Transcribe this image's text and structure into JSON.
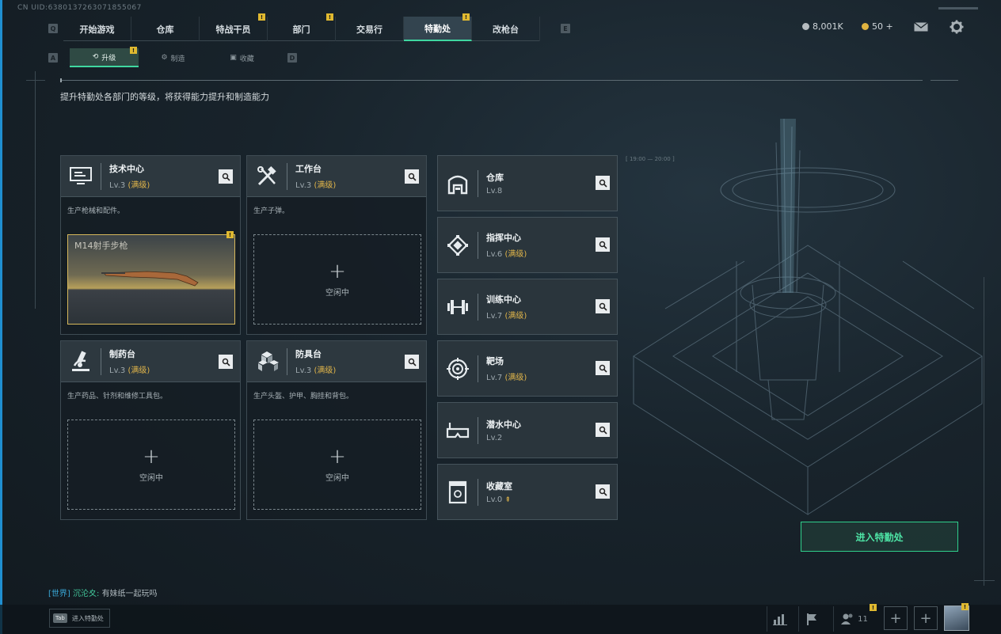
{
  "uid": "CN UID:6380137263071855067",
  "nav": {
    "left_key": "Q",
    "right_key": "E",
    "tabs": [
      {
        "label": "开始游戏",
        "alert": ""
      },
      {
        "label": "仓库",
        "alert": ""
      },
      {
        "label": "特战干员",
        "alert": "!"
      },
      {
        "label": "部门",
        "alert": "!"
      },
      {
        "label": "交易行",
        "alert": ""
      },
      {
        "label": "特勤处",
        "alert": "!",
        "active": true
      },
      {
        "label": "改枪台",
        "alert": ""
      }
    ]
  },
  "currency": {
    "main": "8,001K",
    "secondary": "50 +"
  },
  "subnav": {
    "left_key": "A",
    "right_key": "D",
    "tabs": [
      {
        "label": "升级",
        "alert": "!",
        "active": true
      },
      {
        "label": "制造",
        "alert": ""
      },
      {
        "label": "收藏",
        "alert": ""
      }
    ]
  },
  "description": "提升特勤处各部门的等级，将获得能力提升和制造能力",
  "slot_idle": "空闲中",
  "slot_plus": "+",
  "max_tag": "(满级)",
  "cards": {
    "tech": {
      "name": "技术中心",
      "level": "Lv.3",
      "desc": "生产枪械和配件。",
      "item": "M14射手步枪",
      "item_alert": "!"
    },
    "workbench": {
      "name": "工作台",
      "level": "Lv.3",
      "desc": "生产子弹。"
    },
    "pharmacy": {
      "name": "制药台",
      "level": "Lv.3",
      "desc": "生产药品、针剂和维修工具包。"
    },
    "armor": {
      "name": "防具台",
      "level": "Lv.3",
      "desc": "生产头盔、护甲、胸挂和背包。"
    }
  },
  "side": [
    {
      "name": "仓库",
      "level": "Lv.8",
      "max": ""
    },
    {
      "name": "指挥中心",
      "level": "Lv.6",
      "max": "(满级)"
    },
    {
      "name": "训练中心",
      "level": "Lv.7",
      "max": "(满级)"
    },
    {
      "name": "靶场",
      "level": "Lv.7",
      "max": "(满级)"
    },
    {
      "name": "潜水中心",
      "level": "Lv.2",
      "max": ""
    },
    {
      "name": "收藏室",
      "level": "Lv.0",
      "max": ""
    }
  ],
  "enter_button": "进入特勤处",
  "chat": {
    "channel": "[世界]",
    "user": "沉沦夊:",
    "message": "有妹纸一起玩吗"
  },
  "tab_hint": {
    "key": "Tab",
    "label": "进入特勤处"
  },
  "bottom": {
    "friends_count": "11",
    "alert": "!"
  }
}
